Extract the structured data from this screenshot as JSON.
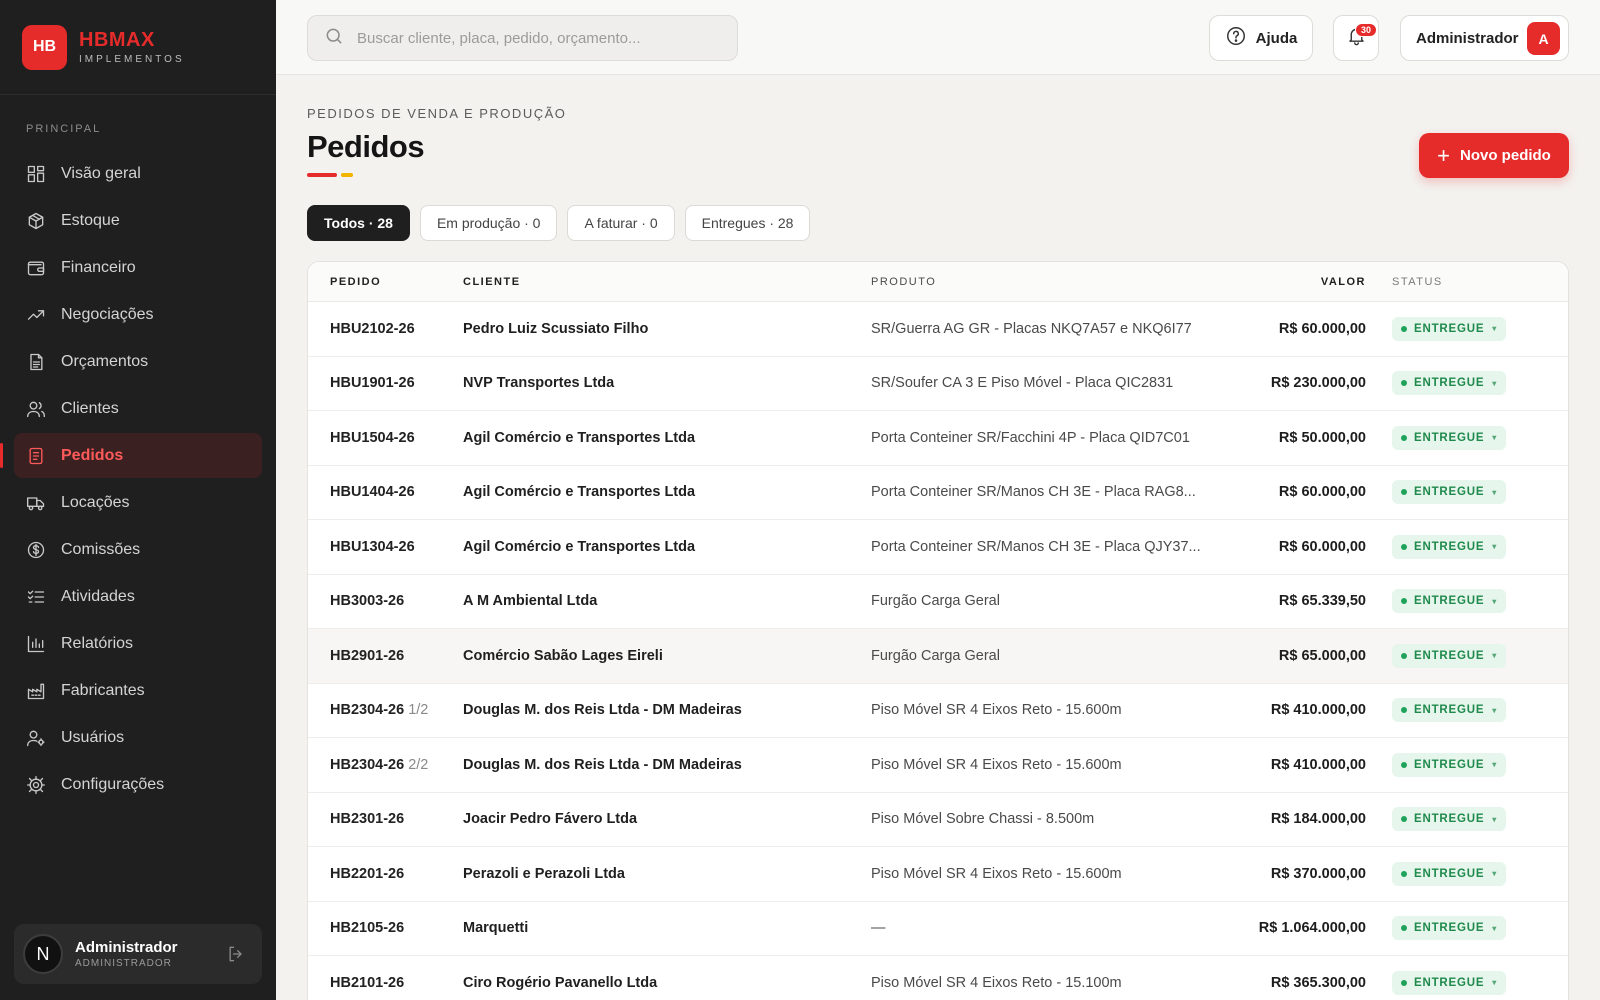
{
  "brand": {
    "logo": "HB",
    "name": "HBMAX",
    "sub": "IMPLEMENTOS"
  },
  "sidebar": {
    "section": "PRINCIPAL",
    "items": [
      {
        "label": "Visão geral",
        "icon": "grid-icon"
      },
      {
        "label": "Estoque",
        "icon": "box-icon"
      },
      {
        "label": "Financeiro",
        "icon": "wallet-icon"
      },
      {
        "label": "Negociações",
        "icon": "trend-icon"
      },
      {
        "label": "Orçamentos",
        "icon": "document-icon"
      },
      {
        "label": "Clientes",
        "icon": "users-icon"
      },
      {
        "label": "Pedidos",
        "icon": "orders-icon",
        "active": true
      },
      {
        "label": "Locações",
        "icon": "truck-icon"
      },
      {
        "label": "Comissões",
        "icon": "dollar-icon"
      },
      {
        "label": "Atividades",
        "icon": "checklist-icon"
      },
      {
        "label": "Relatórios",
        "icon": "bar-chart-icon"
      },
      {
        "label": "Fabricantes",
        "icon": "factory-icon"
      },
      {
        "label": "Usuários",
        "icon": "user-gear-icon"
      },
      {
        "label": "Configurações",
        "icon": "gear-icon"
      }
    ],
    "user": {
      "initial": "N",
      "name": "Administrador",
      "role": "ADMINISTRADOR"
    }
  },
  "topbar": {
    "search_placeholder": "Buscar cliente, placa, pedido, orçamento...",
    "help_label": "Ajuda",
    "notifications_count": "30",
    "admin_label": "Administrador",
    "admin_initial": "A"
  },
  "page": {
    "eyebrow": "PEDIDOS DE VENDA E PRODUÇÃO",
    "title": "Pedidos",
    "new_button": "Novo pedido",
    "filters": [
      "Todos · 28",
      "Em produção · 0",
      "A faturar · 0",
      "Entregues · 28"
    ]
  },
  "table": {
    "headers": {
      "pedido": "PEDIDO",
      "cliente": "CLIENTE",
      "produto": "PRODUTO",
      "valor": "VALOR",
      "status": "STATUS"
    },
    "rows": [
      {
        "pedido": "HBU2102-26",
        "sub": "",
        "cliente": "Pedro Luiz Scussiato Filho",
        "produto": "SR/Guerra AG GR - Placas NKQ7A57 e NKQ6I77",
        "valor": "R$ 60.000,00",
        "status": "ENTREGUE"
      },
      {
        "pedido": "HBU1901-26",
        "sub": "",
        "cliente": "NVP Transportes Ltda",
        "produto": "SR/Soufer CA 3 E Piso Móvel - Placa QIC2831",
        "valor": "R$ 230.000,00",
        "status": "ENTREGUE"
      },
      {
        "pedido": "HBU1504-26",
        "sub": "",
        "cliente": "Agil Comércio e Transportes Ltda",
        "produto": "Porta Conteiner SR/Facchini 4P - Placa QID7C01",
        "valor": "R$ 50.000,00",
        "status": "ENTREGUE"
      },
      {
        "pedido": "HBU1404-26",
        "sub": "",
        "cliente": "Agil Comércio e Transportes Ltda",
        "produto": "Porta Conteiner SR/Manos CH 3E - Placa RAG8...",
        "valor": "R$ 60.000,00",
        "status": "ENTREGUE"
      },
      {
        "pedido": "HBU1304-26",
        "sub": "",
        "cliente": "Agil Comércio e Transportes Ltda",
        "produto": "Porta Conteiner SR/Manos CH 3E - Placa QJY37...",
        "valor": "R$ 60.000,00",
        "status": "ENTREGUE"
      },
      {
        "pedido": "HB3003-26",
        "sub": "",
        "cliente": "A M Ambiental Ltda",
        "produto": "Furgão Carga Geral",
        "valor": "R$ 65.339,50",
        "status": "ENTREGUE"
      },
      {
        "pedido": "HB2901-26",
        "sub": "",
        "cliente": "Comércio Sabão Lages Eireli",
        "produto": "Furgão Carga Geral",
        "valor": "R$ 65.000,00",
        "status": "ENTREGUE",
        "highlight": true
      },
      {
        "pedido": "HB2304-26",
        "sub": "1/2",
        "cliente": "Douglas M. dos Reis Ltda - DM Madeiras",
        "produto": "Piso Móvel SR 4 Eixos Reto - 15.600m",
        "valor": "R$ 410.000,00",
        "status": "ENTREGUE"
      },
      {
        "pedido": "HB2304-26",
        "sub": "2/2",
        "cliente": "Douglas M. dos Reis Ltda - DM Madeiras",
        "produto": "Piso Móvel SR 4 Eixos Reto - 15.600m",
        "valor": "R$ 410.000,00",
        "status": "ENTREGUE"
      },
      {
        "pedido": "HB2301-26",
        "sub": "",
        "cliente": "Joacir Pedro Fávero Ltda",
        "produto": "Piso Móvel Sobre Chassi - 8.500m",
        "valor": "R$ 184.000,00",
        "status": "ENTREGUE"
      },
      {
        "pedido": "HB2201-26",
        "sub": "",
        "cliente": "Perazoli e Perazoli Ltda",
        "produto": "Piso Móvel SR 4 Eixos Reto - 15.600m",
        "valor": "R$ 370.000,00",
        "status": "ENTREGUE"
      },
      {
        "pedido": "HB2105-26",
        "sub": "",
        "cliente": "Marquetti",
        "produto": "—",
        "valor": "R$ 1.064.000,00",
        "status": "ENTREGUE"
      },
      {
        "pedido": "HB2101-26",
        "sub": "",
        "cliente": "Ciro Rogério Pavanello Ltda",
        "produto": "Piso Móvel SR 4 Eixos Reto - 15.100m",
        "valor": "R$ 365.300,00",
        "status": "ENTREGUE"
      }
    ]
  }
}
